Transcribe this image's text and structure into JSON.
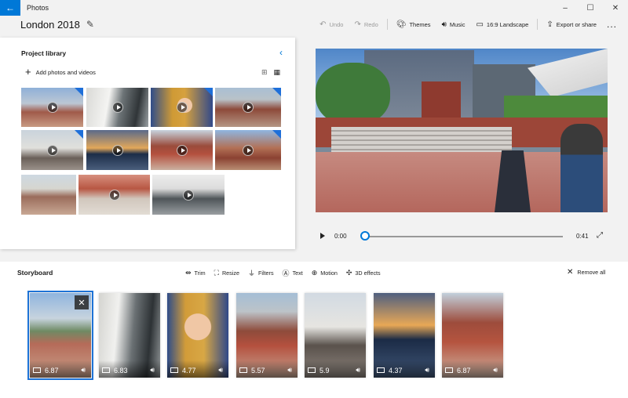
{
  "window": {
    "app_title": "Photos",
    "back_icon": "back-arrow-icon",
    "minimize": "–",
    "maximize": "☐",
    "close": "✕"
  },
  "header": {
    "project_title": "London 2018",
    "toolbar": {
      "undo": "Undo",
      "redo": "Redo",
      "themes": "Themes",
      "music": "Music",
      "aspect": "16:9 Landscape",
      "export": "Export or share",
      "more": "..."
    }
  },
  "library": {
    "title": "Project library",
    "add_label": "Add photos and videos",
    "accent_color": "#0078d7",
    "thumbnails": [
      {
        "id": 1,
        "type": "video",
        "in_project": true
      },
      {
        "id": 2,
        "type": "video",
        "in_project": false
      },
      {
        "id": 3,
        "type": "video",
        "in_project": true
      },
      {
        "id": 4,
        "type": "video",
        "in_project": false
      },
      {
        "id": 5,
        "type": "video",
        "in_project": true
      },
      {
        "id": 6,
        "type": "video",
        "in_project": false
      },
      {
        "id": 7,
        "type": "video",
        "in_project": false
      },
      {
        "id": 8,
        "type": "video",
        "in_project": true
      },
      {
        "id": 9,
        "type": "photo",
        "in_project": false
      },
      {
        "id": 10,
        "type": "video",
        "in_project": false
      },
      {
        "id": 11,
        "type": "video",
        "in_project": false
      }
    ]
  },
  "player": {
    "current_time": "0:00",
    "duration": "0:41",
    "progress_fraction": 0
  },
  "storyboard": {
    "title": "Storyboard",
    "tools": [
      {
        "label": "Trim",
        "icon": "trim-icon"
      },
      {
        "label": "Resize",
        "icon": "resize-icon"
      },
      {
        "label": "Filters",
        "icon": "filters-icon"
      },
      {
        "label": "Text",
        "icon": "text-icon"
      },
      {
        "label": "Motion",
        "icon": "motion-icon"
      },
      {
        "label": "3D effects",
        "icon": "3d-effects-icon"
      }
    ],
    "remove_all": "Remove all",
    "clips": [
      {
        "duration": "6.87",
        "selected": true
      },
      {
        "duration": "6.83",
        "selected": false
      },
      {
        "duration": "4.77",
        "selected": false
      },
      {
        "duration": "5.57",
        "selected": false
      },
      {
        "duration": "5.9",
        "selected": false
      },
      {
        "duration": "4.37",
        "selected": false
      },
      {
        "duration": "6.87",
        "selected": false
      }
    ]
  }
}
